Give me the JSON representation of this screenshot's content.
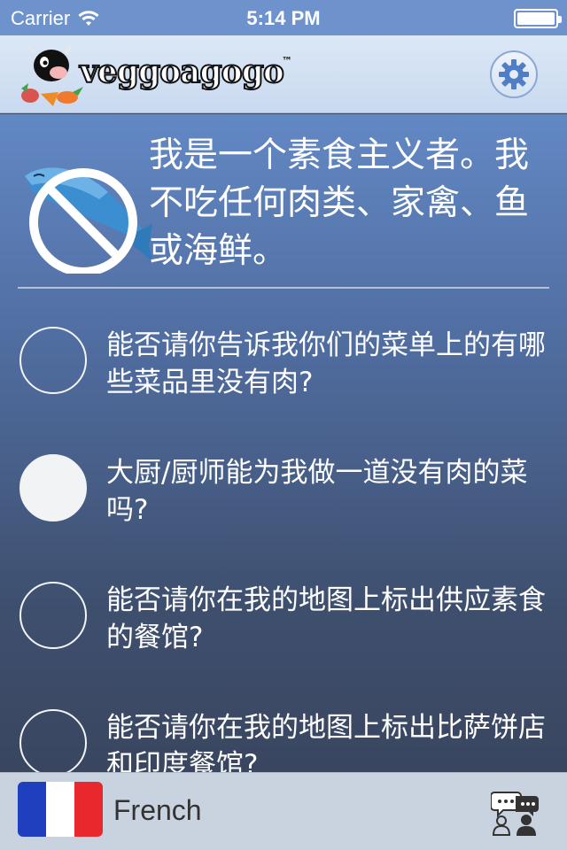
{
  "status_bar": {
    "carrier": "Carrier",
    "time": "5:14 PM"
  },
  "header": {
    "logo_text": "veggoagogo",
    "logo_tm": "™",
    "settings_icon": "gear-icon"
  },
  "statement": {
    "icon": "no-fish-icon",
    "text": "我是一个素食主义者。我不吃任何肉类、家禽、鱼或海鲜。"
  },
  "phrases": [
    {
      "text": "能否请你告诉我你们的菜单上的有哪些菜品里没有肉?",
      "selected": false
    },
    {
      "text": "大厨/厨师能为我做一道没有肉的菜吗?",
      "selected": true
    },
    {
      "text": "能否请你在我的地图上标出供应素食的餐馆?",
      "selected": false
    },
    {
      "text": "能否请你在我的地图上标出比萨饼店和印度餐馆?",
      "selected": false
    }
  ],
  "footer": {
    "language": "French",
    "flag_icon": "france-flag-icon",
    "chat_icon": "conversation-icon"
  },
  "colors": {
    "accent": "#4f7dc7",
    "nav_bg": "#dce8f7",
    "flag_blue": "#1f3fbf",
    "flag_red": "#e8282d"
  }
}
